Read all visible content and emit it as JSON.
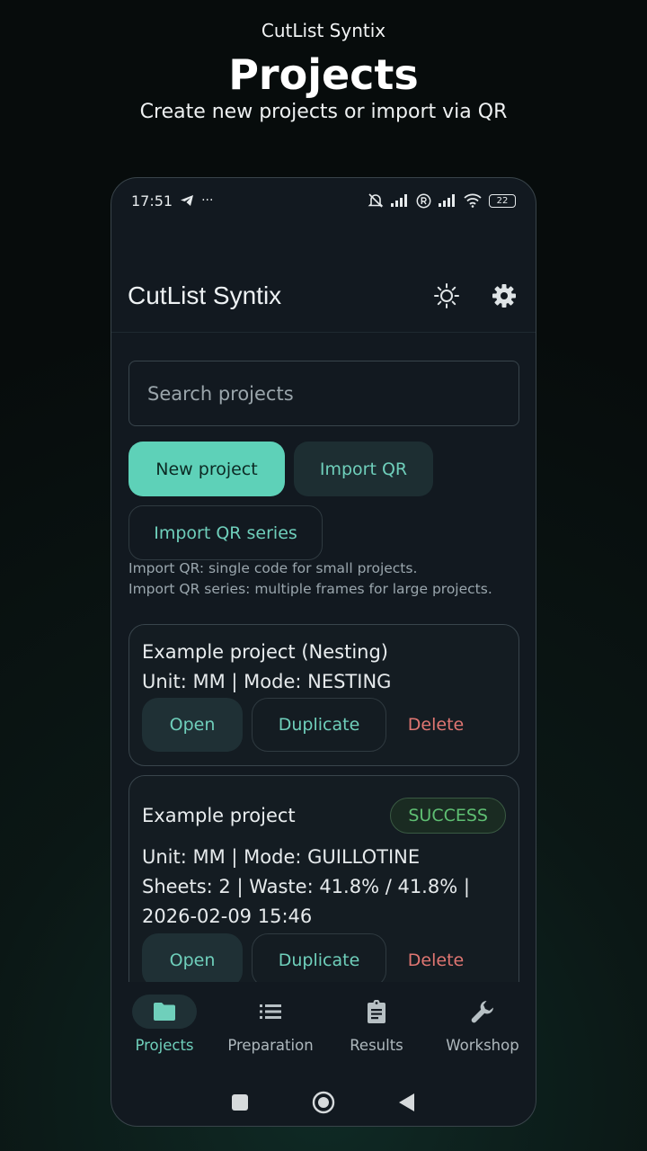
{
  "promo": {
    "brand": "CutList Syntix",
    "title": "Projects",
    "subtitle": "Create new projects or import via QR"
  },
  "statusbar": {
    "time": "17:51",
    "dots": "···",
    "battery": "22"
  },
  "appbar": {
    "title": "CutList Syntix",
    "theme_icon": "sun-icon",
    "settings_icon": "gear-icon"
  },
  "search": {
    "placeholder": "Search projects"
  },
  "actions": {
    "new_project": "New project",
    "import_qr": "Import QR",
    "import_qr_series": "Import QR series"
  },
  "hints": [
    "Import QR: single code for small projects.",
    "Import QR series: multiple frames for large projects."
  ],
  "projects": [
    {
      "title": "Example project (Nesting)",
      "lines": [
        "Unit: MM | Mode: NESTING"
      ],
      "open": "Open",
      "duplicate": "Duplicate",
      "delete": "Delete"
    },
    {
      "title": "Example project",
      "badge": "SUCCESS",
      "lines": [
        "Unit: MM | Mode: GUILLOTINE",
        "Sheets: 2 | Waste: 41.8% / 41.8% |",
        "2026-02-09 15:46"
      ],
      "open": "Open",
      "duplicate": "Duplicate",
      "delete": "Delete"
    }
  ],
  "nav": [
    {
      "label": "Projects",
      "icon": "folder-icon",
      "active": true
    },
    {
      "label": "Preparation",
      "icon": "list-icon",
      "active": false
    },
    {
      "label": "Results",
      "icon": "clipboard-icon",
      "active": false
    },
    {
      "label": "Workshop",
      "icon": "wrench-icon",
      "active": false
    }
  ],
  "colors": {
    "accent": "#5ed1b8",
    "accent_text": "#6fcfbb",
    "danger": "#e07672",
    "success": "#5fbf73",
    "background": "#121920"
  }
}
